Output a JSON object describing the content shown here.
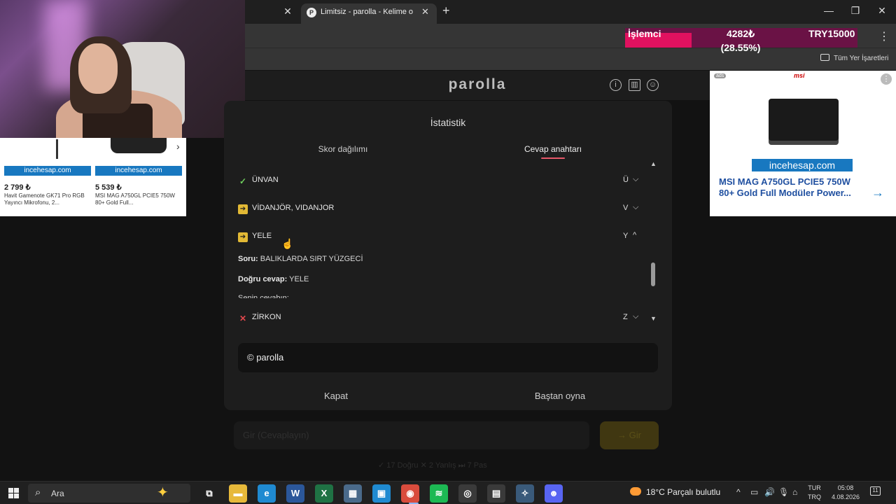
{
  "browser": {
    "active_tab_title": "Limitsiz - parolla - Kelime o",
    "favicon_letter": "P",
    "new_tab": "+",
    "close": "✕",
    "minimize": "—",
    "maximize": "❐",
    "menu": "⋮",
    "bookmarks_all": "Tüm Yer İşaretleri"
  },
  "donation": {
    "label": "İşlemci",
    "amount": "4282₺",
    "percent_text": "(28.55%)",
    "progress": 0.2855,
    "goal": "TRY15000"
  },
  "site": {
    "logo": "parolla",
    "info_icon": "i",
    "stats_icon": "▥",
    "profile_icon": "☺"
  },
  "modal": {
    "title": "İstatistik",
    "tabs": [
      {
        "label": "Skor dağılımı",
        "active": false
      },
      {
        "label": "Cevap anahtarı",
        "active": true
      }
    ],
    "rows": [
      {
        "status": "correct",
        "word": "ÜNVAN",
        "letter": "Ü",
        "chevron": "⌵"
      },
      {
        "status": "pass",
        "word": "VİDANJÖR, VIDANJOR",
        "letter": "V",
        "chevron": "⌵"
      },
      {
        "status": "pass",
        "word": "YELE",
        "letter": "Y",
        "chevron": "^"
      },
      {
        "status": "wrong",
        "word": "ZİRKON",
        "letter": "Z",
        "chevron": "⌵"
      }
    ],
    "icons": {
      "correct": "✓",
      "pass": "➔",
      "wrong": "✕"
    },
    "detail": {
      "question_label": "Soru:",
      "question": "BALIKLARDA SIRT YÜZGECİ",
      "answer_label": "Doğru cevap:",
      "answer": "YELE",
      "clipped": "Senin cevabın:"
    },
    "copyright": "© parolla",
    "close_button": "Kapat",
    "restart_button": "Baştan oyna",
    "scroll_up": "▲",
    "scroll_down": "▼"
  },
  "background_page": {
    "input_placeholder": "Gir (Cevaplayın)",
    "submit_label": "→ Gir",
    "stats": "✓ 17 Doğru   ✕ 2 Yanlış   ⏭ 7 Pas"
  },
  "ads": {
    "left": [
      {
        "brand": "incehesap.com",
        "price": "2 799 ₺",
        "title": "Havit Gamenote GK71 Pro RGB Yayıncı Mikrofonu, 2..."
      },
      {
        "brand": "incehesap.com",
        "price": "5 539 ₺",
        "title": "MSI MAG A750GL PCIE5 750W 80+ Gold Full..."
      }
    ],
    "left_arrow": "›",
    "right": {
      "badge": "ads",
      "info": "⋮",
      "logo": "msi",
      "brand": "incehesap.com",
      "title": "MSI MAG A750GL PCIE5 750W 80+ Gold Full Modüler Power...",
      "arrow": "→"
    }
  },
  "taskbar": {
    "search_placeholder": "Ara",
    "search_icon": "⌕",
    "sparkle": "✦",
    "apps": [
      {
        "name": "task-view",
        "glyph": "⧉",
        "color": "#202020"
      },
      {
        "name": "file-explorer",
        "glyph": "▬",
        "color": "#e7b93a"
      },
      {
        "name": "edge",
        "glyph": "e",
        "color": "#1f8ad1"
      },
      {
        "name": "word",
        "glyph": "W",
        "color": "#2b579a"
      },
      {
        "name": "excel",
        "glyph": "X",
        "color": "#1f7244"
      },
      {
        "name": "calculator",
        "glyph": "▦",
        "color": "#4a6a8a"
      },
      {
        "name": "store",
        "glyph": "▣",
        "color": "#1f8ad1"
      },
      {
        "name": "chrome",
        "glyph": "◉",
        "color": "#d94c3d"
      },
      {
        "name": "spotify",
        "glyph": "≋",
        "color": "#1db954"
      },
      {
        "name": "obs",
        "glyph": "◎",
        "color": "#3a3a3a"
      },
      {
        "name": "streamlabs",
        "glyph": "▤",
        "color": "#3a3a3a"
      },
      {
        "name": "app",
        "glyph": "✧",
        "color": "#3a5a7a"
      },
      {
        "name": "discord",
        "glyph": "☻",
        "color": "#5865f2"
      }
    ],
    "weather": "18°C  Parçalı bulutlu",
    "tray_chevron": "^",
    "tray_icons": [
      "▭",
      "🔊",
      "🎙",
      "⌂"
    ],
    "lang_top": "TUR",
    "lang_bottom": "TRQ",
    "time": "05:08",
    "date": "4.08.2026",
    "notifications": "11"
  },
  "colors": {
    "accent": "#e8596a",
    "donation_fill": "#e0115f",
    "donation_bg": "#6a1245",
    "correct": "#6fcf5d",
    "pass": "#e2b935",
    "wrong": "#e0474c"
  }
}
